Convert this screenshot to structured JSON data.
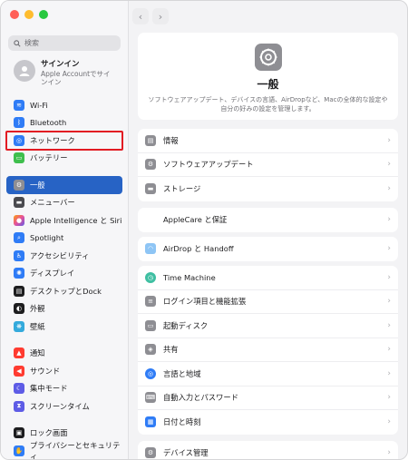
{
  "window": {
    "traffic_colors": [
      "#ff5f57",
      "#febc2e",
      "#28c840"
    ]
  },
  "sidebar": {
    "search_placeholder": "検索",
    "account": {
      "title": "サインイン",
      "subtitle": "Apple Accountでサインイン"
    },
    "items": [
      {
        "label": "Wi-Fi",
        "icon": "wifi-icon",
        "color": "#2f7cf6"
      },
      {
        "label": "Bluetooth",
        "icon": "bluetooth-icon",
        "color": "#2f7cf6"
      },
      {
        "label": "ネットワーク",
        "icon": "globe-icon",
        "color": "#2f7cf6",
        "highlighted": true
      },
      {
        "label": "バッテリー",
        "icon": "battery-icon",
        "color": "#3fbf4d"
      },
      {
        "label": "一般",
        "icon": "gear-icon",
        "color": "#8e8e93",
        "selected": true
      },
      {
        "label": "メニューバー",
        "icon": "menubar-icon",
        "color": "#4a4a4f"
      },
      {
        "label": "Apple Intelligence と Siri",
        "icon": "siri-icon",
        "color": "#e6509b"
      },
      {
        "label": "Spotlight",
        "icon": "spotlight-icon",
        "color": "#2f7cf6"
      },
      {
        "label": "アクセシビリティ",
        "icon": "accessibility-icon",
        "color": "#2f7cf6"
      },
      {
        "label": "ディスプレイ",
        "icon": "display-icon",
        "color": "#2f7cf6"
      },
      {
        "label": "デスクトップとDock",
        "icon": "dock-icon",
        "color": "#1d1d1f"
      },
      {
        "label": "外観",
        "icon": "appearance-icon",
        "color": "#1d1d1f"
      },
      {
        "label": "壁紙",
        "icon": "wallpaper-icon",
        "color": "#34aadc"
      },
      {
        "label": "通知",
        "icon": "bell-icon",
        "color": "#ff3b30"
      },
      {
        "label": "サウンド",
        "icon": "speaker-icon",
        "color": "#ff3b30"
      },
      {
        "label": "集中モード",
        "icon": "moon-icon",
        "color": "#5e5ce6"
      },
      {
        "label": "スクリーンタイム",
        "icon": "hourglass-icon",
        "color": "#5e5ce6"
      },
      {
        "label": "ロック画面",
        "icon": "lock-icon",
        "color": "#1d1d1f"
      },
      {
        "label": "プライバシーとセキュリティ",
        "icon": "hand-icon",
        "color": "#2f7cf6"
      }
    ]
  },
  "main": {
    "nav": {
      "back": "‹",
      "forward": "›"
    },
    "hero": {
      "title": "一般",
      "description": "ソフトウェアアップデート、デバイスの言語、AirDropなど、Macの全体的な設定や自分の好みの設定を管理します。"
    },
    "groups": [
      {
        "rows": [
          {
            "label": "情報",
            "icon": "info-icon",
            "color": "#8e8e93"
          },
          {
            "label": "ソフトウェアアップデート",
            "icon": "gear-badge-icon",
            "color": "#8e8e93"
          },
          {
            "label": "ストレージ",
            "icon": "storage-icon",
            "color": "#8e8e93"
          }
        ]
      },
      {
        "rows": [
          {
            "label": "AppleCare と保証",
            "icon": "apple-icon",
            "color": "#ff3b30"
          }
        ]
      },
      {
        "rows": [
          {
            "label": "AirDrop と Handoff",
            "icon": "airdrop-icon",
            "color": "#8ec5f5"
          }
        ]
      },
      {
        "rows": [
          {
            "label": "Time Machine",
            "icon": "timemachine-icon",
            "color": "#3fbfa2"
          },
          {
            "label": "ログイン項目と機能拡張",
            "icon": "list-icon",
            "color": "#8e8e93"
          },
          {
            "label": "起動ディスク",
            "icon": "disk-icon",
            "color": "#8e8e93"
          },
          {
            "label": "共有",
            "icon": "share-icon",
            "color": "#8e8e93"
          },
          {
            "label": "言語と地域",
            "icon": "globe-icon",
            "color": "#2f7cf6"
          },
          {
            "label": "自動入力とパスワード",
            "icon": "keyboard-icon",
            "color": "#8e8e93"
          },
          {
            "label": "日付と時刻",
            "icon": "calendar-icon",
            "color": "#2f7cf6"
          }
        ]
      },
      {
        "rows": [
          {
            "label": "デバイス管理",
            "icon": "device-gear-icon",
            "color": "#8e8e93"
          }
        ]
      }
    ],
    "chevron": "›"
  }
}
